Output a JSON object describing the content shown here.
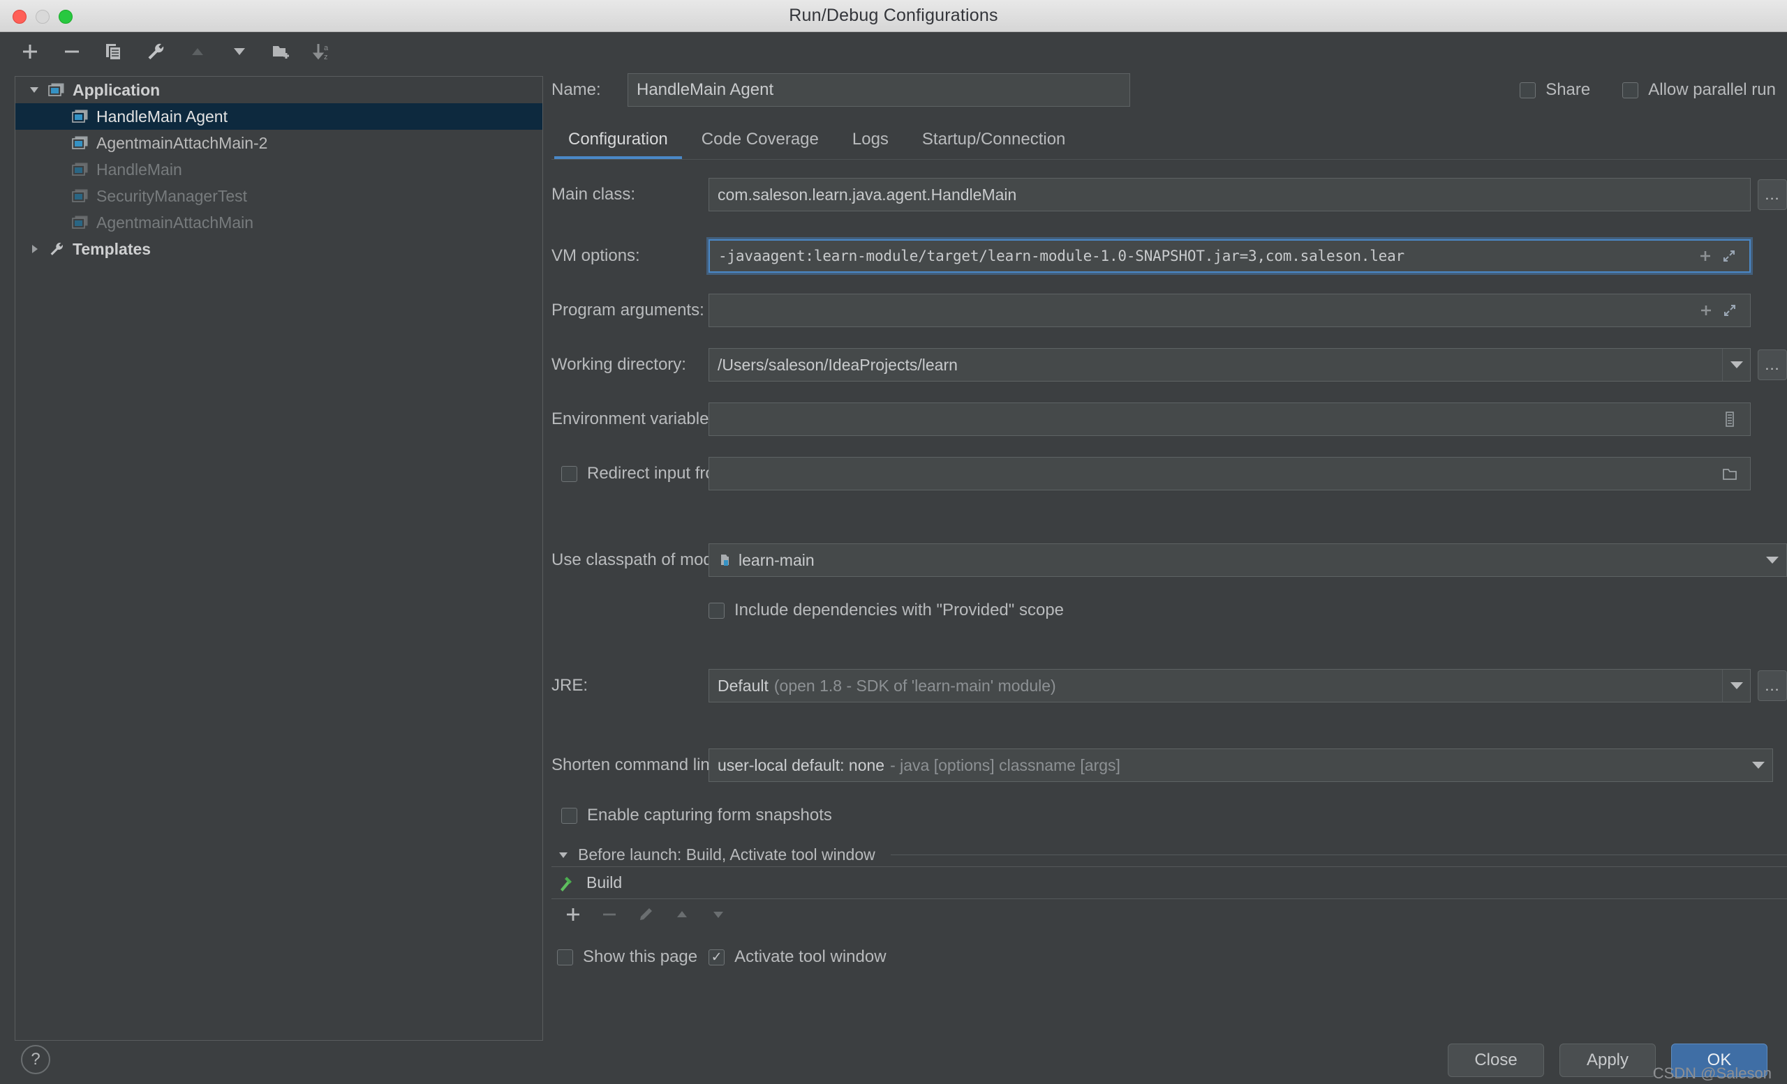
{
  "window": {
    "title": "Run/Debug Configurations",
    "traffic_lights": [
      "close-red",
      "minimize-yellow",
      "zoom-green"
    ]
  },
  "toolbar": {
    "buttons": [
      {
        "name": "add",
        "icon": "plus-icon",
        "enabled": true
      },
      {
        "name": "remove",
        "icon": "minus-icon",
        "enabled": true
      },
      {
        "name": "copy",
        "icon": "copy-icon",
        "enabled": true
      },
      {
        "name": "edit-templates",
        "icon": "wrench-icon",
        "enabled": true
      },
      {
        "name": "move-up",
        "icon": "triangle-up-icon",
        "enabled": false
      },
      {
        "name": "move-down",
        "icon": "triangle-down-icon",
        "enabled": true
      },
      {
        "name": "new-folder",
        "icon": "folder-add-icon",
        "enabled": true
      },
      {
        "name": "sort-alphabetically",
        "icon": "sort-az-icon",
        "enabled": true
      }
    ]
  },
  "tree": {
    "items": [
      {
        "label": "Application",
        "level": 0,
        "expander": "down",
        "icon": "application-icon",
        "bold": true,
        "dim": false,
        "selected": false
      },
      {
        "label": "HandleMain Agent",
        "level": 1,
        "expander": "none",
        "icon": "application-icon",
        "bold": false,
        "dim": false,
        "selected": true
      },
      {
        "label": "AgentmainAttachMain-2",
        "level": 1,
        "expander": "none",
        "icon": "application-icon",
        "bold": false,
        "dim": false,
        "selected": false
      },
      {
        "label": "HandleMain",
        "level": 1,
        "expander": "none",
        "icon": "application-icon",
        "bold": false,
        "dim": true,
        "selected": false
      },
      {
        "label": "SecurityManagerTest",
        "level": 1,
        "expander": "none",
        "icon": "application-icon",
        "bold": false,
        "dim": true,
        "selected": false
      },
      {
        "label": "AgentmainAttachMain",
        "level": 1,
        "expander": "none",
        "icon": "application-icon",
        "bold": false,
        "dim": true,
        "selected": false
      },
      {
        "label": "Templates",
        "level": 0,
        "expander": "right",
        "icon": "wrench-icon",
        "bold": true,
        "dim": false,
        "selected": false
      }
    ]
  },
  "header": {
    "name_label": "Name:",
    "name_value": "HandleMain Agent",
    "name_placeholder": "",
    "share_label": "Share",
    "share_checked": false,
    "parallel_label": "Allow parallel run",
    "parallel_checked": false
  },
  "tabs": {
    "items": [
      {
        "label": "Configuration",
        "active": true
      },
      {
        "label": "Code Coverage",
        "active": false
      },
      {
        "label": "Logs",
        "active": false
      },
      {
        "label": "Startup/Connection",
        "active": false
      }
    ],
    "accent_color": "#4a88c7"
  },
  "configuration": {
    "main_class": {
      "label": "Main class:",
      "value": "com.saleson.learn.java.agent.HandleMain",
      "browse_label": "..."
    },
    "vm_options": {
      "label": "VM options:",
      "value": "-javaagent:learn-module/target/learn-module-1.0-SNAPSHOT.jar=3,com.saleson.lear",
      "focused": true,
      "macro_icon": "plus-icon",
      "expand_icon": "expand-diagonal-icon"
    },
    "program_arguments": {
      "label": "Program arguments:",
      "value": "",
      "macro_icon": "plus-icon",
      "expand_icon": "expand-diagonal-icon"
    },
    "working_directory": {
      "label": "Working directory:",
      "value": "/Users/saleson/IdeaProjects/learn",
      "browse_label": "..."
    },
    "environment_variables": {
      "label": "Environment variables:",
      "value": "",
      "editor_icon": "list-editor-icon"
    },
    "redirect_input": {
      "label": "Redirect input from:",
      "checked": false,
      "value": "",
      "browse_icon": "folder-icon"
    },
    "classpath_module": {
      "label": "Use classpath of module:",
      "value": "learn-main",
      "icon": "module-icon"
    },
    "include_provided": {
      "label": "Include dependencies with \"Provided\" scope",
      "checked": false
    },
    "jre": {
      "label": "JRE:",
      "value_bright": "Default",
      "value_dim": "(open 1.8 - SDK of 'learn-main' module)",
      "browse_label": "..."
    },
    "shorten_command_line": {
      "label": "Shorten command line:",
      "value_bright": "user-local default: none",
      "value_dim": "- java [options] classname [args]"
    },
    "form_snapshots": {
      "label": "Enable capturing form snapshots",
      "checked": false
    }
  },
  "before_launch": {
    "header": "Before launch: Build, Activate tool window",
    "tasks": [
      {
        "label": "Build",
        "icon": "hammer-icon"
      }
    ],
    "tools": [
      {
        "name": "add-task",
        "icon": "plus-icon",
        "enabled": true
      },
      {
        "name": "remove-task",
        "icon": "minus-icon",
        "enabled": false
      },
      {
        "name": "edit-task",
        "icon": "pencil-icon",
        "enabled": false
      },
      {
        "name": "move-task-up",
        "icon": "triangle-up-icon",
        "enabled": false
      },
      {
        "name": "move-task-down",
        "icon": "triangle-down-icon",
        "enabled": false
      }
    ],
    "show_page": {
      "label": "Show this page",
      "checked": false
    },
    "activate_tool_window": {
      "label": "Activate tool window",
      "checked": true
    }
  },
  "footer": {
    "help_label": "?",
    "close_label": "Close",
    "apply_label": "Apply",
    "ok_label": "OK",
    "watermark": "CSDN @Saleson"
  }
}
